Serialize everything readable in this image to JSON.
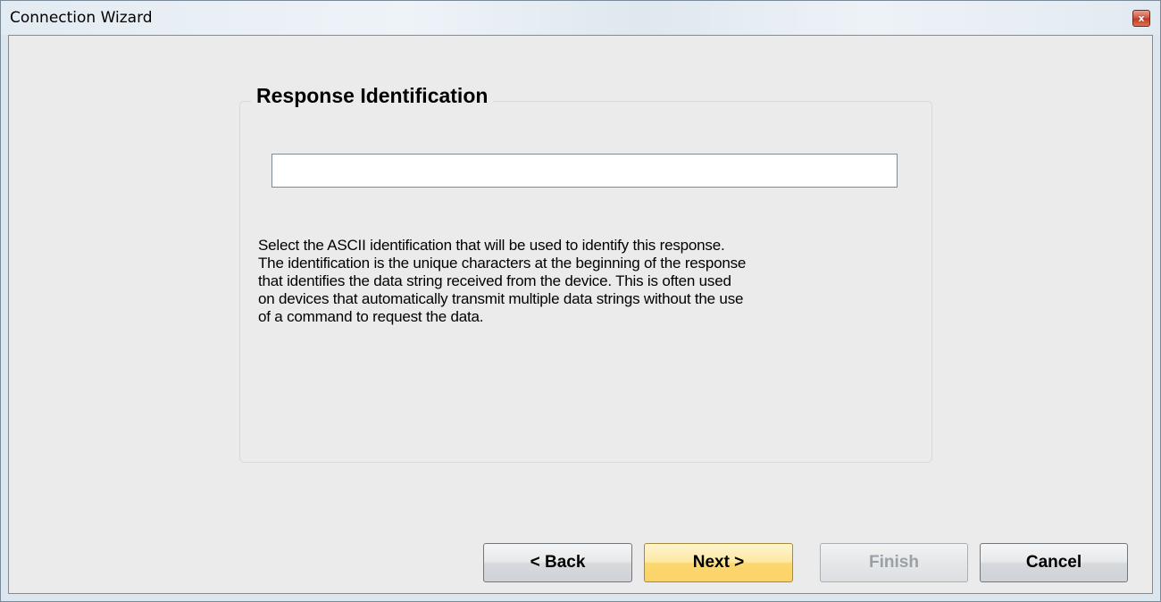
{
  "window": {
    "title": "Connection Wizard",
    "close_label": "x"
  },
  "group": {
    "title": "Response Identification"
  },
  "identification_input": {
    "value": "",
    "placeholder": ""
  },
  "description": {
    "lines": [
      "Select the ASCII identification that will be used to identify this response.",
      "The identification is the unique characters at the beginning of the response",
      "that identifies the data string received from the device.  This is often used",
      "on devices that automatically transmit multiple data strings without the use",
      "of a command to request the data."
    ]
  },
  "buttons": {
    "back": "< Back",
    "next": "Next >",
    "finish": "Finish",
    "cancel": "Cancel"
  },
  "colors": {
    "default_button": "#fbd86e",
    "close_button": "#d2523a"
  }
}
